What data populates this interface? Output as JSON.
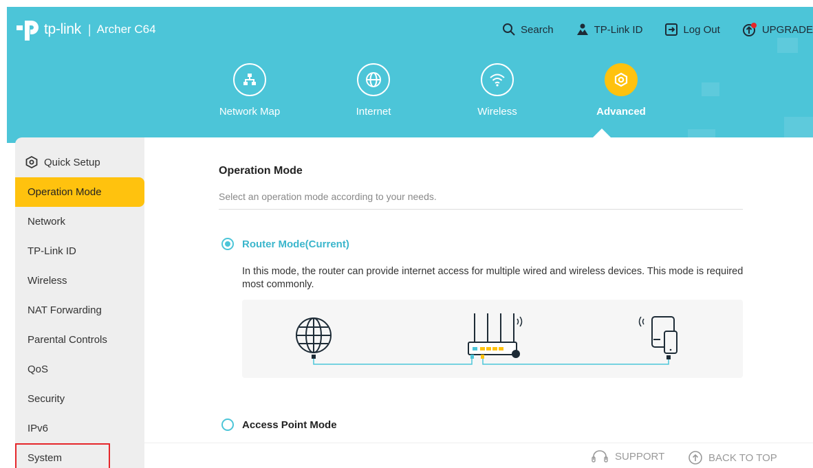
{
  "header": {
    "brand": "tp-link",
    "separator": "|",
    "model": "Archer C64",
    "top_links": {
      "search": "Search",
      "tplink_id": "TP-Link ID",
      "logout": "Log Out",
      "upgrade": "UPGRADE"
    },
    "nav": [
      {
        "label": "Network Map",
        "icon": "network-map-icon"
      },
      {
        "label": "Internet",
        "icon": "globe-icon"
      },
      {
        "label": "Wireless",
        "icon": "wifi-icon"
      },
      {
        "label": "Advanced",
        "icon": "advanced-gear-icon",
        "active": true
      }
    ]
  },
  "sidebar": {
    "items": [
      {
        "label": "Quick Setup"
      },
      {
        "label": "Operation Mode",
        "active": true
      },
      {
        "label": "Network"
      },
      {
        "label": "TP-Link ID"
      },
      {
        "label": "Wireless"
      },
      {
        "label": "NAT Forwarding"
      },
      {
        "label": "Parental Controls"
      },
      {
        "label": "QoS"
      },
      {
        "label": "Security"
      },
      {
        "label": "IPv6"
      },
      {
        "label": "System",
        "highlighted": true
      }
    ]
  },
  "main": {
    "title": "Operation Mode",
    "subtitle": "Select an operation mode according to your needs.",
    "modes": [
      {
        "label": "Router Mode(Current)",
        "selected": true
      },
      {
        "label": "Access Point Mode",
        "selected": false
      }
    ],
    "router_description": "In this mode, the router can provide internet access for multiple wired and wireless devices. This mode is required most commonly."
  },
  "footer": {
    "support": "SUPPORT",
    "back_to_top": "BACK TO TOP"
  },
  "colors": {
    "header_bg": "#4cc5d8",
    "accent_yellow": "#ffc20e",
    "accent_cyan": "#3bb6cc",
    "highlight_red": "#e5262a"
  }
}
